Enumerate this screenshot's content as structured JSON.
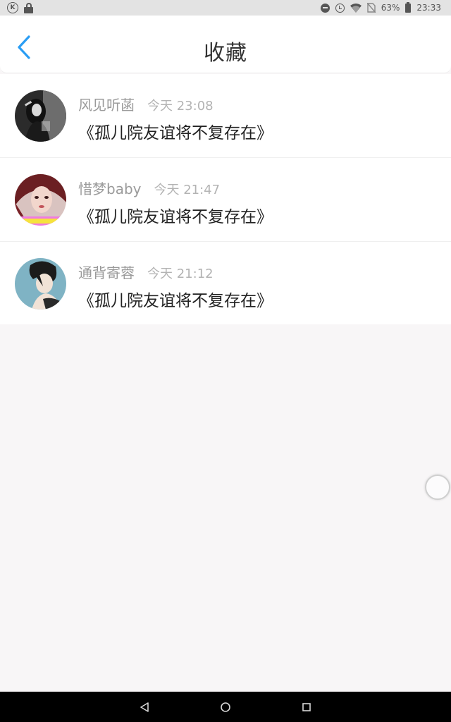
{
  "status_bar": {
    "battery_percent": "63%",
    "time": "23:33",
    "left_icons": [
      "k-icon",
      "lock-icon"
    ],
    "right_icons": [
      "dnd-icon",
      "alarm-icon",
      "wifi-icon",
      "no-sim-icon",
      "battery-icon"
    ]
  },
  "header": {
    "title": "收藏",
    "back_icon": "chevron-left-icon",
    "accent_color": "#2a9df4"
  },
  "favorites": [
    {
      "username": "风见听菡",
      "time": "今天 23:08",
      "title": "《孤儿院友谊将不复存在》",
      "avatar": "avatar-singer-bw"
    },
    {
      "username": "惜梦baby",
      "time": "今天 21:47",
      "title": "《孤儿院友谊将不复存在》",
      "avatar": "avatar-girl-red"
    },
    {
      "username": "通背寄蓉",
      "time": "今天 21:12",
      "title": "《孤儿院友谊将不复存在》",
      "avatar": "avatar-anime-boy"
    }
  ],
  "nav_bar": {
    "back": "nav-back-icon",
    "home": "nav-home-icon",
    "recents": "nav-recents-icon"
  }
}
